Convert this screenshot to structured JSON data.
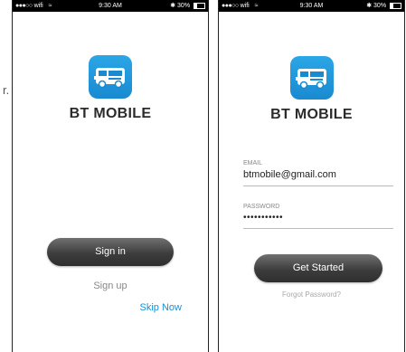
{
  "stray_text_a": "r.",
  "stray_text_b": "",
  "screen1": {
    "status": {
      "carrier": "wifi",
      "time": "9:30 AM",
      "battery": "30%"
    },
    "brand": "BT MOBILE",
    "signin_label": "Sign in",
    "signup_label": "Sign up",
    "skip_label": "Skip Now"
  },
  "screen2": {
    "status": {
      "carrier": "wifi",
      "time": "9:30 AM",
      "battery": "30%"
    },
    "brand": "BT MOBILE",
    "email_label": "EMAIL",
    "email_value": "btmobile@gmail.com",
    "password_label": "PASSWORD",
    "password_value": "•••••••••••",
    "getstarted_label": "Get Started",
    "forgot_label": "Forgot Password?"
  },
  "colors": {
    "accent": "#1a8fd1",
    "icon_bg": "#2aa6e6",
    "button_dark": "#3d3d3d"
  },
  "icons": [
    "bus-icon",
    "wifi-icon",
    "bluetooth-icon",
    "battery-icon"
  ]
}
